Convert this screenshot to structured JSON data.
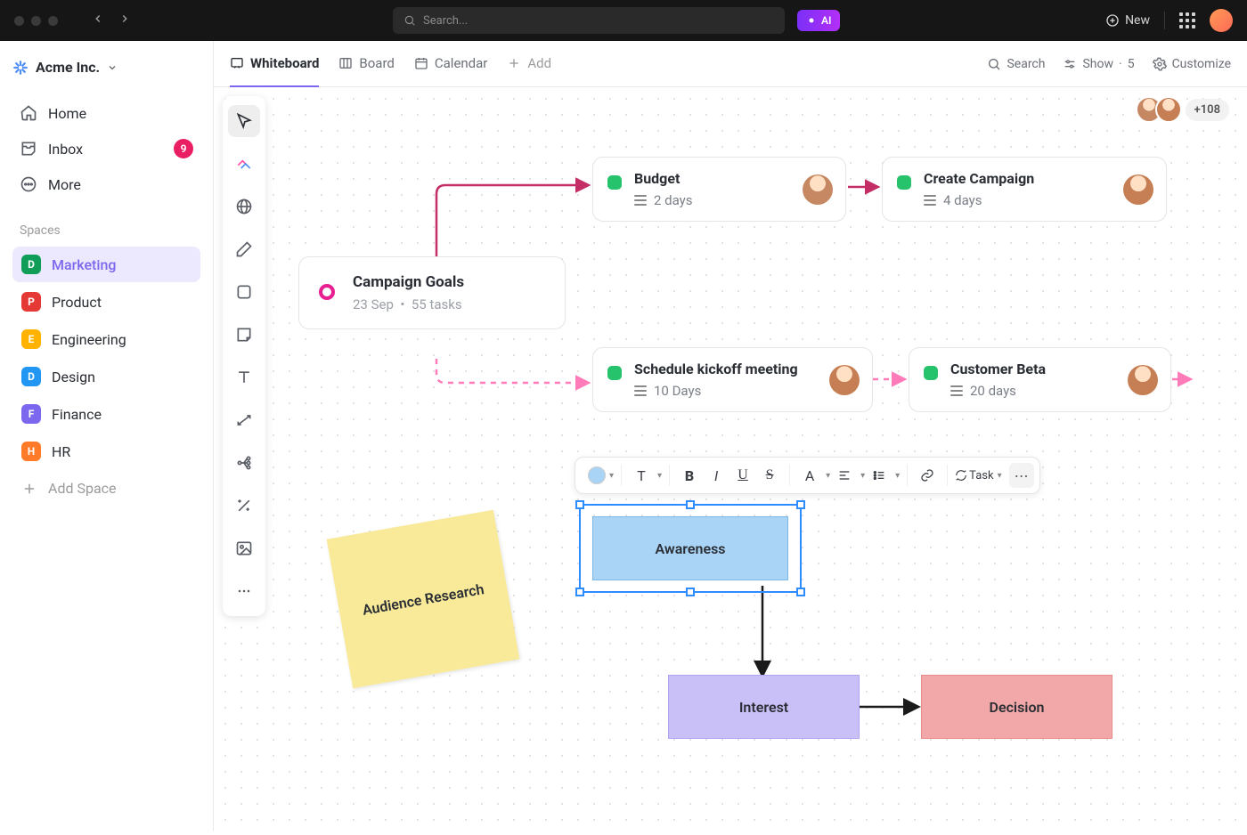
{
  "topbar": {
    "search_placeholder": "Search...",
    "ai_label": "AI",
    "new_label": "New"
  },
  "workspace": {
    "name": "Acme Inc."
  },
  "nav": {
    "home": "Home",
    "inbox": "Inbox",
    "inbox_badge": "9",
    "more": "More"
  },
  "spaces_label": "Spaces",
  "spaces": [
    {
      "letter": "D",
      "color": "#0f9d58",
      "label": "Marketing",
      "active": true
    },
    {
      "letter": "P",
      "color": "#e53935",
      "label": "Product",
      "active": false
    },
    {
      "letter": "E",
      "color": "#ffb300",
      "label": "Engineering",
      "active": false
    },
    {
      "letter": "D",
      "color": "#2196f3",
      "label": "Design",
      "active": false
    },
    {
      "letter": "F",
      "color": "#7b68ee",
      "label": "Finance",
      "active": false
    },
    {
      "letter": "H",
      "color": "#ff7a29",
      "label": "HR",
      "active": false
    }
  ],
  "add_space": "Add Space",
  "tabs": {
    "whiteboard": "Whiteboard",
    "board": "Board",
    "calendar": "Calendar",
    "add": "Add",
    "search": "Search",
    "show": "Show",
    "show_count": "5",
    "customize": "Customize"
  },
  "collaborators": {
    "overflow": "+108"
  },
  "cards": {
    "goals": {
      "title": "Campaign Goals",
      "date": "23 Sep",
      "tasks": "55 tasks"
    },
    "budget": {
      "title": "Budget",
      "meta": "2 days"
    },
    "campaign": {
      "title": "Create Campaign",
      "meta": "4 days"
    },
    "kickoff": {
      "title": "Schedule kickoff meeting",
      "meta": "10 Days"
    },
    "beta": {
      "title": "Customer Beta",
      "meta": "20 days"
    }
  },
  "sticky": {
    "text": "Audience Research"
  },
  "diagram": {
    "awareness": "Awareness",
    "interest": "Interest",
    "decision": "Decision"
  },
  "text_toolbar": {
    "task": "Task"
  }
}
